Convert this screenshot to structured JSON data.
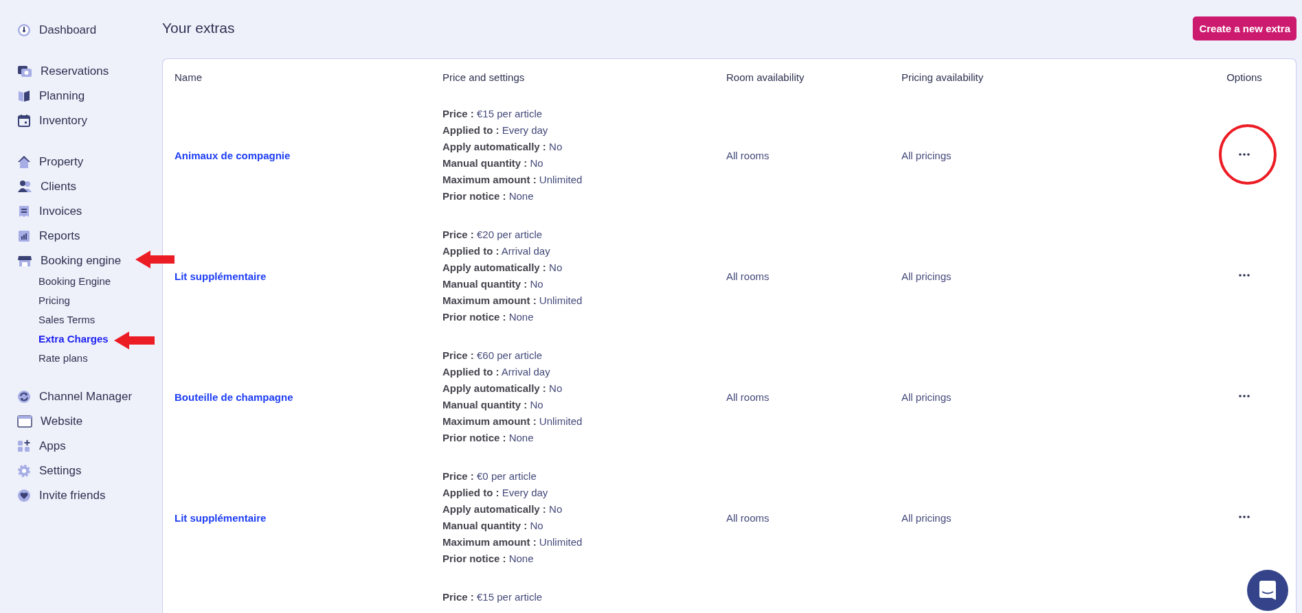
{
  "sidebar": {
    "groups": [
      [
        {
          "label": "Dashboard"
        }
      ],
      [
        {
          "label": "Reservations"
        },
        {
          "label": "Planning"
        },
        {
          "label": "Inventory"
        }
      ],
      [
        {
          "label": "Property"
        },
        {
          "label": "Clients"
        },
        {
          "label": "Invoices"
        },
        {
          "label": "Reports"
        },
        {
          "label": "Booking engine",
          "expanded": true,
          "children": [
            {
              "label": "Booking Engine",
              "selected": false
            },
            {
              "label": "Pricing",
              "selected": false
            },
            {
              "label": "Sales Terms",
              "selected": false
            },
            {
              "label": "Extra Charges",
              "selected": true
            },
            {
              "label": "Rate plans",
              "selected": false
            }
          ]
        }
      ],
      [
        {
          "label": "Channel Manager"
        },
        {
          "label": "Website"
        },
        {
          "label": "Apps"
        },
        {
          "label": "Settings"
        },
        {
          "label": "Invite friends"
        }
      ]
    ]
  },
  "page": {
    "title": "Your extras",
    "create_button": "Create a new extra"
  },
  "table": {
    "columns": [
      "Name",
      "Price and settings",
      "Room availability",
      "Pricing availability",
      "Options"
    ],
    "rows": [
      {
        "name": "Animaux de compagnie",
        "settings": [
          "**Price :** €15 per article",
          "**Applied to :** Every day",
          "**Apply automatically :** No",
          "**Manual quantity :** No",
          "**Maximum amount :** Unlimited",
          "**Prior notice :** None"
        ],
        "rooms": "All rooms",
        "pricings": "All pricings"
      },
      {
        "name": "Lit supplémentaire",
        "settings": [
          "**Price :** €20 per article",
          "**Applied to :** Arrival day",
          "**Apply automatically :** No",
          "**Manual quantity :** No",
          "**Maximum amount :** Unlimited",
          "**Prior notice :** None"
        ],
        "rooms": "All rooms",
        "pricings": "All pricings"
      },
      {
        "name": "Bouteille de champagne",
        "settings": [
          "**Price :** €60 per article",
          "**Applied to :** Arrival day",
          "**Apply automatically :** No",
          "**Manual quantity :** No",
          "**Maximum amount :** Unlimited",
          "**Prior notice :** None"
        ],
        "rooms": "All rooms",
        "pricings": "All pricings"
      },
      {
        "name": "Lit supplémentaire",
        "settings": [
          "**Price :** €0 per article",
          "**Applied to :** Every day",
          "**Apply automatically :** No",
          "**Manual quantity :** No",
          "**Maximum amount :** Unlimited",
          "**Prior notice :** None"
        ],
        "rooms": "All rooms",
        "pricings": "All pricings"
      },
      {
        "settings": [
          "**Price :** €15 per article"
        ]
      }
    ]
  }
}
